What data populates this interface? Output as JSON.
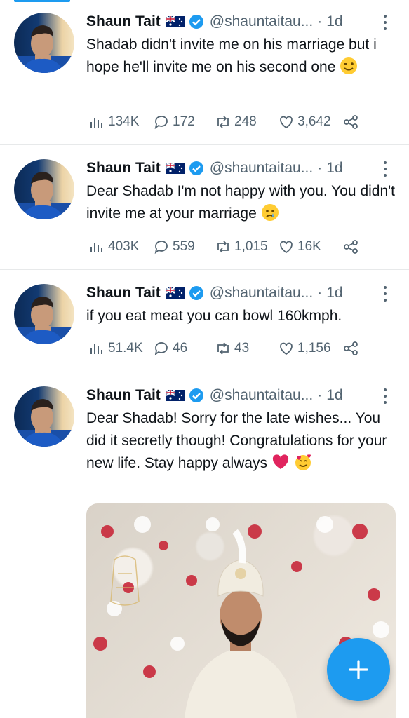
{
  "tweets": [
    {
      "author": {
        "name": "Shaun Tait",
        "handle": "@shauntaitau...",
        "sep": "·",
        "time": "1d"
      },
      "text": "Shadab didn't invite me on his marriage but i hope he'll invite me on his second one",
      "emoji": "winking-face",
      "stats": {
        "views": "134K",
        "replies": "172",
        "retweets": "248",
        "likes": "3,642"
      }
    },
    {
      "author": {
        "name": "Shaun Tait",
        "handle": "@shauntaitau...",
        "sep": "·",
        "time": "1d"
      },
      "text": "Dear Shadab I'm not happy with you. You didn't invite me at your marriage",
      "emoji": "crying-face",
      "stats": {
        "views": "403K",
        "replies": "559",
        "retweets": "1,015",
        "likes": "16K"
      }
    },
    {
      "author": {
        "name": "Shaun Tait",
        "handle": "@shauntaitau...",
        "sep": "·",
        "time": "1d"
      },
      "text": "if you eat meat you can bowl 160kmph.",
      "emoji": "",
      "stats": {
        "views": "51.4K",
        "replies": "46",
        "retweets": "43",
        "likes": "1,156"
      }
    },
    {
      "author": {
        "name": "Shaun Tait",
        "handle": "@shauntaitau...",
        "sep": "·",
        "time": "1d"
      },
      "text": "Dear Shadab! Sorry for the late wishes... You did it secretly though! Congratulations for your new life. Stay happy always",
      "emoji": "red-heart, smiling-face-with-hearts",
      "media": "photo-groom-in-white-sherwani-and-turban"
    }
  ],
  "colors": {
    "accent": "#1d9bf0",
    "text": "#0f1419",
    "secondary": "#536471",
    "heart": "#e0245e"
  },
  "compose_button": {
    "icon": "plus-icon"
  }
}
